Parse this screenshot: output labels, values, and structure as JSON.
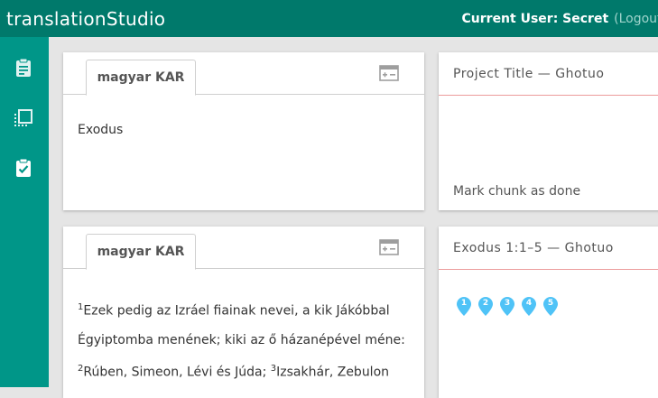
{
  "header": {
    "app_title": "translationStudio",
    "user_label": "Current User: Secret",
    "logout_label": "(Logout)"
  },
  "sidebar": {
    "items": [
      {
        "icon": "clipboard-icon"
      },
      {
        "icon": "select-frame-icon"
      },
      {
        "icon": "clipboard-check-icon"
      }
    ]
  },
  "source_cards": [
    {
      "tab_label": "magyar KAR",
      "text": "Exodus"
    },
    {
      "tab_label": "magyar KAR",
      "verses": [
        {
          "num": "1",
          "text": "Ezek pedig az Izráel fiainak nevei, a kik Jákóbbal"
        },
        {
          "num": "",
          "text": "Égyiptomba menének; kiki az ő házanépével méne:"
        },
        {
          "num": "2",
          "text": "Rúben, Simeon, Lévi és Júda; "
        },
        {
          "num": "3",
          "text": "Izsakhár, Zebulon"
        }
      ]
    }
  ],
  "target_panels": [
    {
      "title": "Project Title — Ghotuo",
      "done_label": "Mark chunk as done"
    },
    {
      "title": "Exodus 1:1–5 — Ghotuo",
      "markers": [
        "1",
        "2",
        "3",
        "4",
        "5"
      ]
    }
  ],
  "colors": {
    "topbar": "#00796b",
    "sidebar": "#009688",
    "marker": "#4fc3f7",
    "title_rule": "#ec9c9c"
  }
}
